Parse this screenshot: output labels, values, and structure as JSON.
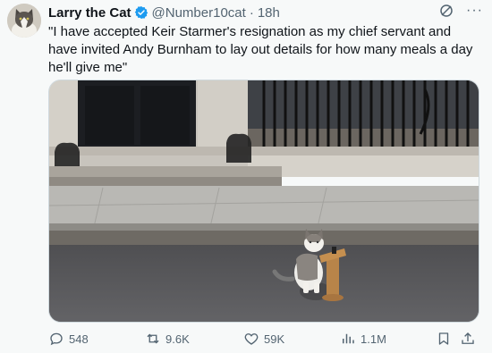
{
  "tweet": {
    "name": "Larry the Cat",
    "handle": "@Number10cat",
    "separator": "·",
    "time": "18h",
    "text": "\"I have accepted Keir Starmer's resignation as my chief servant and have invited Andy Burnham to lay out details for how many meals a day he'll give me\"",
    "more_label": "···"
  },
  "actions": {
    "replies": "548",
    "reposts": "9.6K",
    "likes": "59K",
    "views": "1.1M"
  },
  "colors": {
    "verified": "#1d9bf0",
    "secondary_text": "#536471",
    "background": "#f7f9f9"
  },
  "icons": [
    "verified-badge-icon",
    "grok-icon",
    "more-icon",
    "reply-icon",
    "repost-icon",
    "like-icon",
    "views-icon",
    "bookmark-icon",
    "share-icon"
  ]
}
